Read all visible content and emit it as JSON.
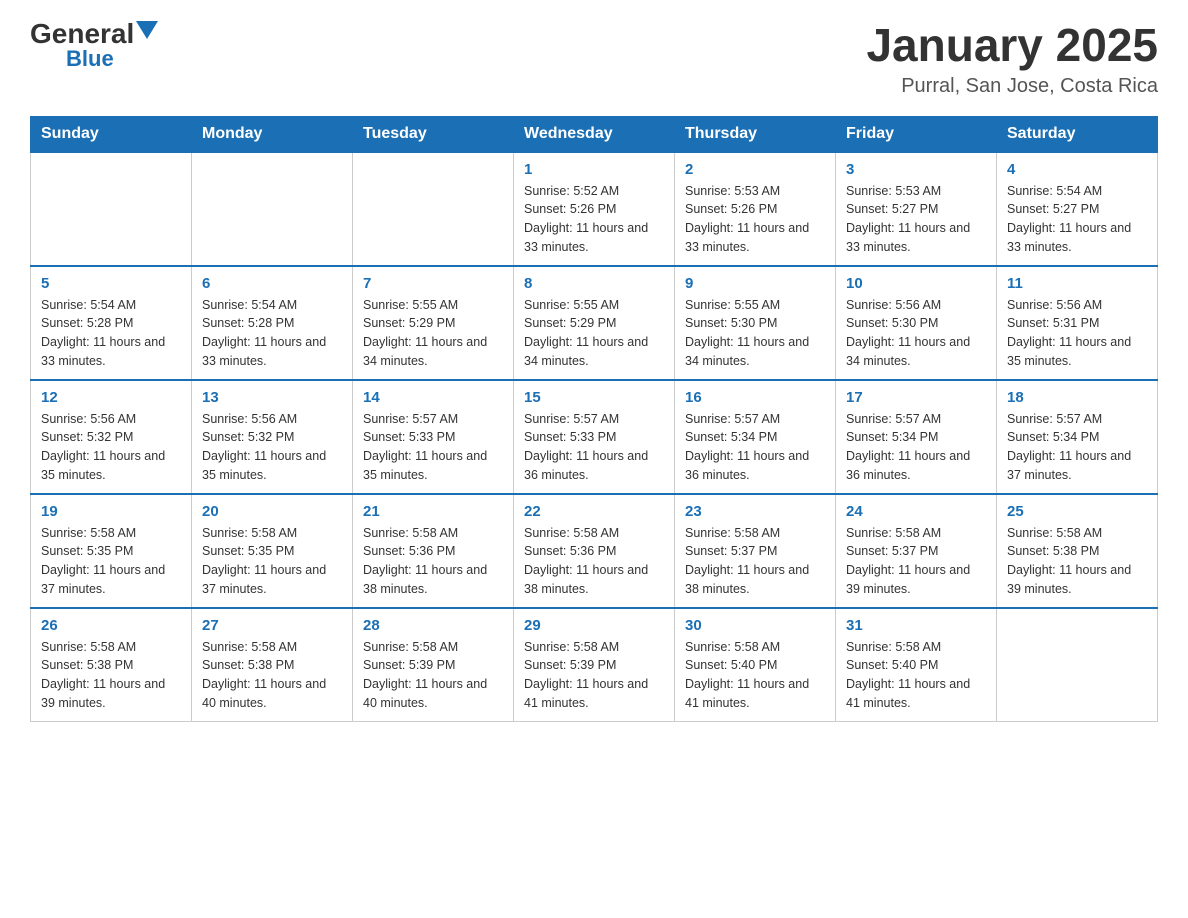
{
  "header": {
    "logo_general": "General",
    "logo_blue": "Blue",
    "month_title": "January 2025",
    "location": "Purral, San Jose, Costa Rica"
  },
  "days_of_week": [
    "Sunday",
    "Monday",
    "Tuesday",
    "Wednesday",
    "Thursday",
    "Friday",
    "Saturday"
  ],
  "weeks": [
    [
      {
        "day": "",
        "info": ""
      },
      {
        "day": "",
        "info": ""
      },
      {
        "day": "",
        "info": ""
      },
      {
        "day": "1",
        "info": "Sunrise: 5:52 AM\nSunset: 5:26 PM\nDaylight: 11 hours and 33 minutes."
      },
      {
        "day": "2",
        "info": "Sunrise: 5:53 AM\nSunset: 5:26 PM\nDaylight: 11 hours and 33 minutes."
      },
      {
        "day": "3",
        "info": "Sunrise: 5:53 AM\nSunset: 5:27 PM\nDaylight: 11 hours and 33 minutes."
      },
      {
        "day": "4",
        "info": "Sunrise: 5:54 AM\nSunset: 5:27 PM\nDaylight: 11 hours and 33 minutes."
      }
    ],
    [
      {
        "day": "5",
        "info": "Sunrise: 5:54 AM\nSunset: 5:28 PM\nDaylight: 11 hours and 33 minutes."
      },
      {
        "day": "6",
        "info": "Sunrise: 5:54 AM\nSunset: 5:28 PM\nDaylight: 11 hours and 33 minutes."
      },
      {
        "day": "7",
        "info": "Sunrise: 5:55 AM\nSunset: 5:29 PM\nDaylight: 11 hours and 34 minutes."
      },
      {
        "day": "8",
        "info": "Sunrise: 5:55 AM\nSunset: 5:29 PM\nDaylight: 11 hours and 34 minutes."
      },
      {
        "day": "9",
        "info": "Sunrise: 5:55 AM\nSunset: 5:30 PM\nDaylight: 11 hours and 34 minutes."
      },
      {
        "day": "10",
        "info": "Sunrise: 5:56 AM\nSunset: 5:30 PM\nDaylight: 11 hours and 34 minutes."
      },
      {
        "day": "11",
        "info": "Sunrise: 5:56 AM\nSunset: 5:31 PM\nDaylight: 11 hours and 35 minutes."
      }
    ],
    [
      {
        "day": "12",
        "info": "Sunrise: 5:56 AM\nSunset: 5:32 PM\nDaylight: 11 hours and 35 minutes."
      },
      {
        "day": "13",
        "info": "Sunrise: 5:56 AM\nSunset: 5:32 PM\nDaylight: 11 hours and 35 minutes."
      },
      {
        "day": "14",
        "info": "Sunrise: 5:57 AM\nSunset: 5:33 PM\nDaylight: 11 hours and 35 minutes."
      },
      {
        "day": "15",
        "info": "Sunrise: 5:57 AM\nSunset: 5:33 PM\nDaylight: 11 hours and 36 minutes."
      },
      {
        "day": "16",
        "info": "Sunrise: 5:57 AM\nSunset: 5:34 PM\nDaylight: 11 hours and 36 minutes."
      },
      {
        "day": "17",
        "info": "Sunrise: 5:57 AM\nSunset: 5:34 PM\nDaylight: 11 hours and 36 minutes."
      },
      {
        "day": "18",
        "info": "Sunrise: 5:57 AM\nSunset: 5:34 PM\nDaylight: 11 hours and 37 minutes."
      }
    ],
    [
      {
        "day": "19",
        "info": "Sunrise: 5:58 AM\nSunset: 5:35 PM\nDaylight: 11 hours and 37 minutes."
      },
      {
        "day": "20",
        "info": "Sunrise: 5:58 AM\nSunset: 5:35 PM\nDaylight: 11 hours and 37 minutes."
      },
      {
        "day": "21",
        "info": "Sunrise: 5:58 AM\nSunset: 5:36 PM\nDaylight: 11 hours and 38 minutes."
      },
      {
        "day": "22",
        "info": "Sunrise: 5:58 AM\nSunset: 5:36 PM\nDaylight: 11 hours and 38 minutes."
      },
      {
        "day": "23",
        "info": "Sunrise: 5:58 AM\nSunset: 5:37 PM\nDaylight: 11 hours and 38 minutes."
      },
      {
        "day": "24",
        "info": "Sunrise: 5:58 AM\nSunset: 5:37 PM\nDaylight: 11 hours and 39 minutes."
      },
      {
        "day": "25",
        "info": "Sunrise: 5:58 AM\nSunset: 5:38 PM\nDaylight: 11 hours and 39 minutes."
      }
    ],
    [
      {
        "day": "26",
        "info": "Sunrise: 5:58 AM\nSunset: 5:38 PM\nDaylight: 11 hours and 39 minutes."
      },
      {
        "day": "27",
        "info": "Sunrise: 5:58 AM\nSunset: 5:38 PM\nDaylight: 11 hours and 40 minutes."
      },
      {
        "day": "28",
        "info": "Sunrise: 5:58 AM\nSunset: 5:39 PM\nDaylight: 11 hours and 40 minutes."
      },
      {
        "day": "29",
        "info": "Sunrise: 5:58 AM\nSunset: 5:39 PM\nDaylight: 11 hours and 41 minutes."
      },
      {
        "day": "30",
        "info": "Sunrise: 5:58 AM\nSunset: 5:40 PM\nDaylight: 11 hours and 41 minutes."
      },
      {
        "day": "31",
        "info": "Sunrise: 5:58 AM\nSunset: 5:40 PM\nDaylight: 11 hours and 41 minutes."
      },
      {
        "day": "",
        "info": ""
      }
    ]
  ]
}
